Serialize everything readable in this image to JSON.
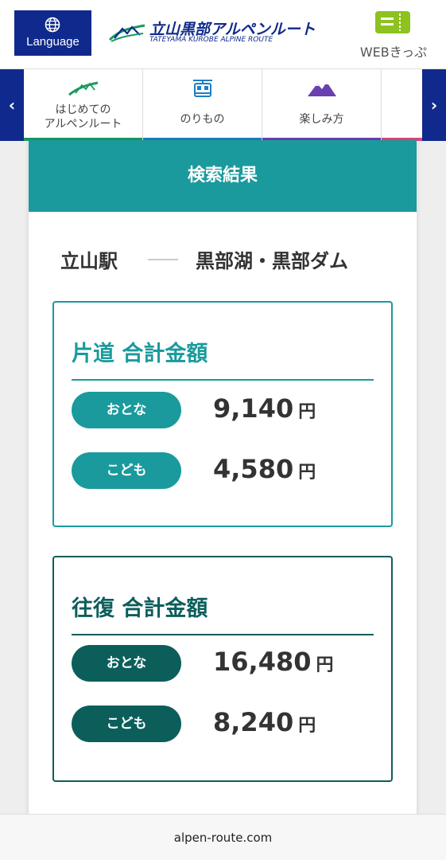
{
  "header": {
    "language_label": "Language",
    "logo_jp": "立山黒部アルペンルート",
    "logo_en": "TATEYAMA KUROBE ALPINE ROUTE",
    "web_ticket_label": "WEBきっぷ"
  },
  "nav": {
    "prev_label": "‹",
    "next_label": "›",
    "items": [
      {
        "line1": "はじめての",
        "line2": "アルペンルート",
        "color": "#1a9a60"
      },
      {
        "line1": "のりもの",
        "color": "#1e7fc4"
      },
      {
        "line1": "楽しみ方",
        "color": "#6a3fb0"
      }
    ],
    "partial_item_color": "#e0457b"
  },
  "result": {
    "title": "検索結果",
    "from": "立山駅",
    "to": "黒部湖・黒部ダム",
    "one_way": {
      "title": "片道 合計金額",
      "adult_label": "おとな",
      "adult_price": "9,140",
      "child_label": "こども",
      "child_price": "4,580",
      "currency": "円"
    },
    "round_trip": {
      "title": "往復 合計金額",
      "adult_label": "おとな",
      "adult_price": "16,480",
      "child_label": "こども",
      "child_price": "8,240",
      "currency": "円"
    }
  },
  "browser": {
    "url": "alpen-route.com"
  },
  "colors": {
    "brand_navy": "#0f2a8c",
    "teal": "#1a9a9c",
    "dark_teal": "#0c5e5b",
    "ticket_green": "#8dc21f"
  }
}
